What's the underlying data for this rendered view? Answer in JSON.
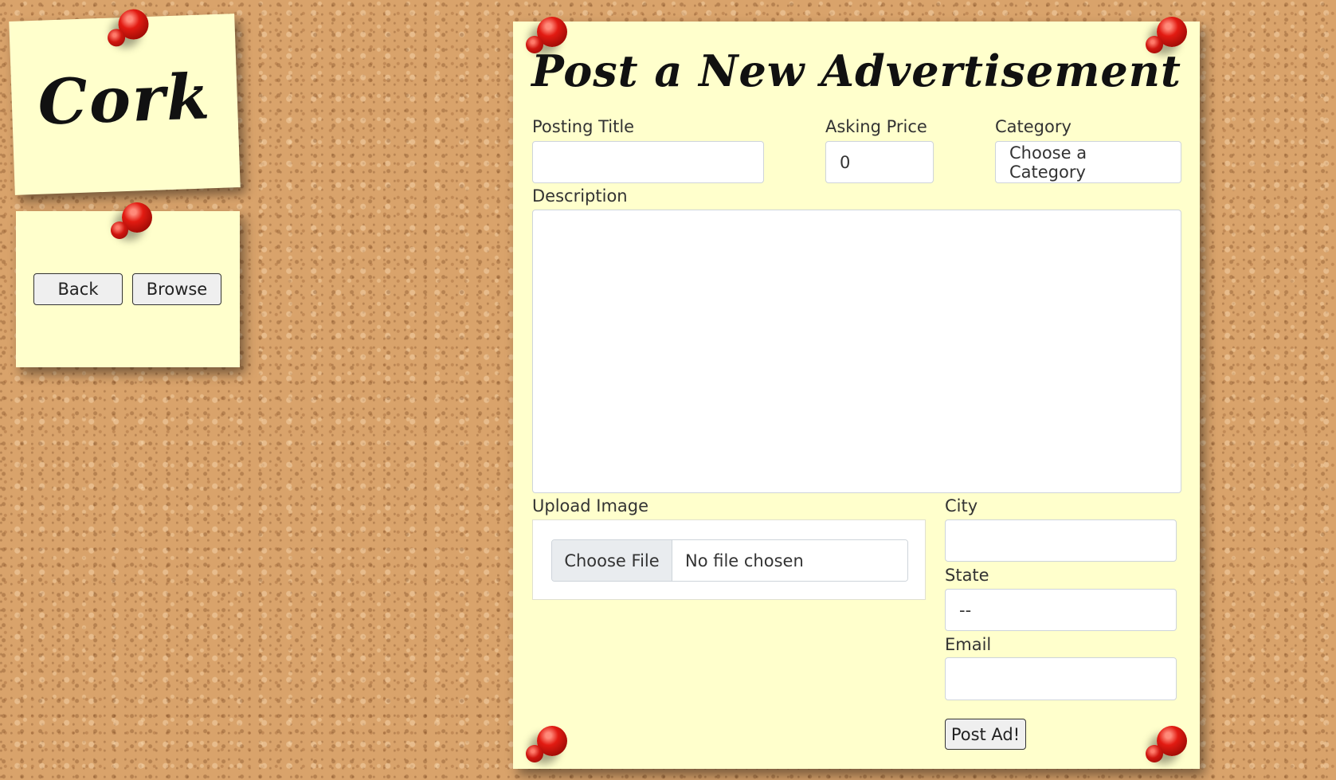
{
  "brand": {
    "title": "Cork"
  },
  "nav": {
    "back_label": "Back",
    "browse_label": "Browse"
  },
  "form": {
    "title": "Post a New Advertisement",
    "posting_title": {
      "label": "Posting Title",
      "value": ""
    },
    "asking_price": {
      "label": "Asking Price",
      "value": "0"
    },
    "category": {
      "label": "Category",
      "value": "Choose a Category"
    },
    "description": {
      "label": "Description",
      "value": ""
    },
    "upload": {
      "label": "Upload Image",
      "button": "Choose File",
      "status": "No file chosen"
    },
    "city": {
      "label": "City",
      "value": ""
    },
    "state": {
      "label": "State",
      "value": "--"
    },
    "email": {
      "label": "Email",
      "value": ""
    },
    "submit_label": "Post Ad!"
  },
  "colors": {
    "note": "#ffffcc",
    "pin": "#e21b12",
    "cork": "#d9a36b"
  }
}
